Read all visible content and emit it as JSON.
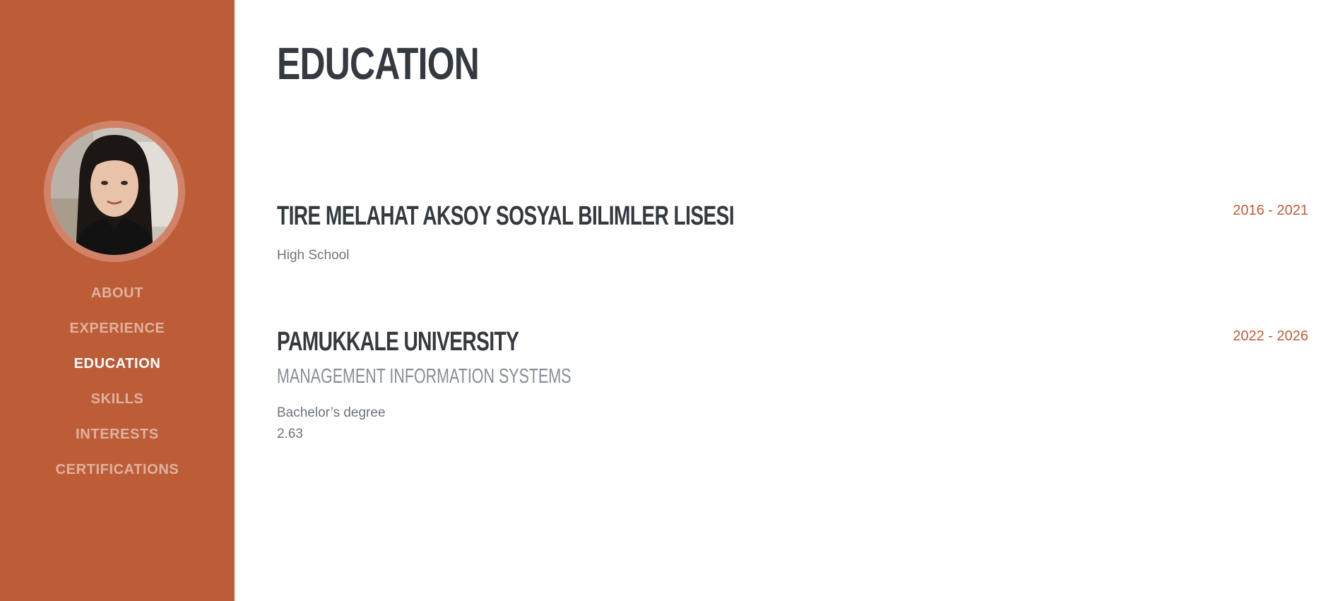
{
  "sidebar": {
    "avatar_alt": "profile photo",
    "nav": [
      {
        "label": "ABOUT",
        "active": false
      },
      {
        "label": "EXPERIENCE",
        "active": false
      },
      {
        "label": "EDUCATION",
        "active": true
      },
      {
        "label": "SKILLS",
        "active": false
      },
      {
        "label": "INTERESTS",
        "active": false
      },
      {
        "label": "CERTIFICATIONS",
        "active": false
      }
    ]
  },
  "main": {
    "title": "EDUCATION",
    "entries": [
      {
        "school": "TIRE MELAHAT AKSOY SOSYAL BILIMLER LISESI",
        "program": "",
        "degree": "High School",
        "gpa": "",
        "date": "2016 - 2021"
      },
      {
        "school": "PAMUKKALE UNIVERSITY",
        "program": "MANAGEMENT INFORMATION SYSTEMS",
        "degree": "Bachelor’s degree",
        "gpa": "2.63",
        "date": "2022 - 2026"
      }
    ]
  },
  "colors": {
    "sidebar_bg": "#bd5d38",
    "heading": "#343a40",
    "accent": "#bd5d38",
    "muted": "#868e96"
  }
}
